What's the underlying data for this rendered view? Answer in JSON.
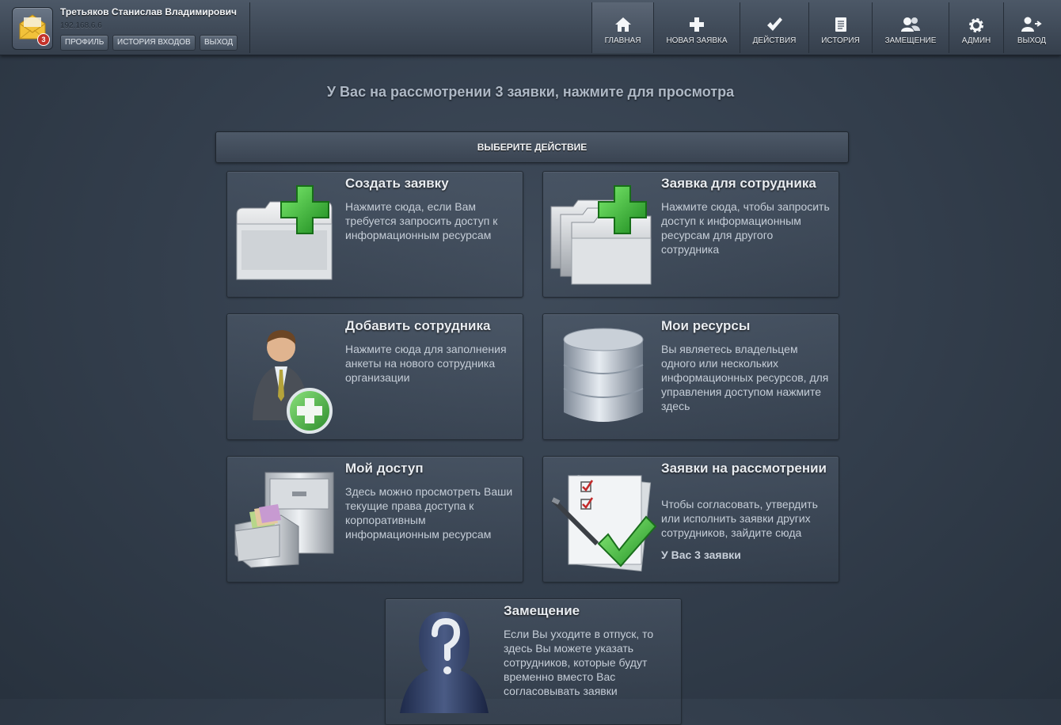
{
  "user": {
    "name": "Третьяков Станислав Владимирович",
    "ip": "192.168.6.6",
    "badge": "3",
    "buttons": [
      "ПРОФИЛЬ",
      "ИСТОРИЯ ВХОДОВ",
      "ВЫХОД"
    ]
  },
  "nav": [
    {
      "label": "ГЛАВНАЯ",
      "icon": "home-icon"
    },
    {
      "label": "НОВАЯ ЗАЯВКА",
      "icon": "plus-icon"
    },
    {
      "label": "ДЕЙСТВИЯ",
      "icon": "checkmark-icon"
    },
    {
      "label": "ИСТОРИЯ",
      "icon": "document-icon"
    },
    {
      "label": "ЗАМЕЩЕНИЕ",
      "icon": "users-icon"
    },
    {
      "label": "АДМИН",
      "icon": "gear-icon"
    },
    {
      "label": "ВЫХОД",
      "icon": "user-logout-icon"
    }
  ],
  "notice": "У Вас на рассмотрении 3 заявки, нажмите для просмотра",
  "panel_title": "ВЫБЕРИТЕ ДЕЙСТВИЕ",
  "cards": [
    {
      "title": "Создать заявку",
      "desc": "Нажмите сюда, если Вам требуется запросить доступ к информационным ресурсам",
      "icon": "folder-plus-icon"
    },
    {
      "title": "Заявка для сотрудника",
      "desc": "Нажмите сюда, чтобы запросить доступ к информационным ресурсам для другого сотрудника",
      "icon": "folders-plus-icon"
    },
    {
      "title": "Добавить сотрудника",
      "desc": "Нажмите сюда для заполнения анкеты на нового сотрудника организации",
      "icon": "person-add-icon"
    },
    {
      "title": "Мои ресурсы",
      "desc": "Вы являетесь владельцем одного или нескольких информационных ресурсов, для управления доступом нажмите здесь",
      "icon": "database-icon"
    },
    {
      "title": "Мой доступ",
      "desc": "Здесь можно просмотреть Ваши текущие права доступа к корпоративным информационным ресурсам",
      "icon": "file-cabinet-icon"
    },
    {
      "title": "Заявки на рассмотрении",
      "desc": "Чтобы согласовать, утвердить или исполнить заявки других сотрудников, зайдите сюда",
      "extra": "У Вас 3 заявки",
      "icon": "checklist-icon"
    },
    {
      "title": "Замещение",
      "desc": "Если Вы уходите в отпуск, то здесь Вы можете указать сотрудников, которые будут временно вместо Вас согласовывать заявки",
      "icon": "unknown-person-icon"
    }
  ]
}
